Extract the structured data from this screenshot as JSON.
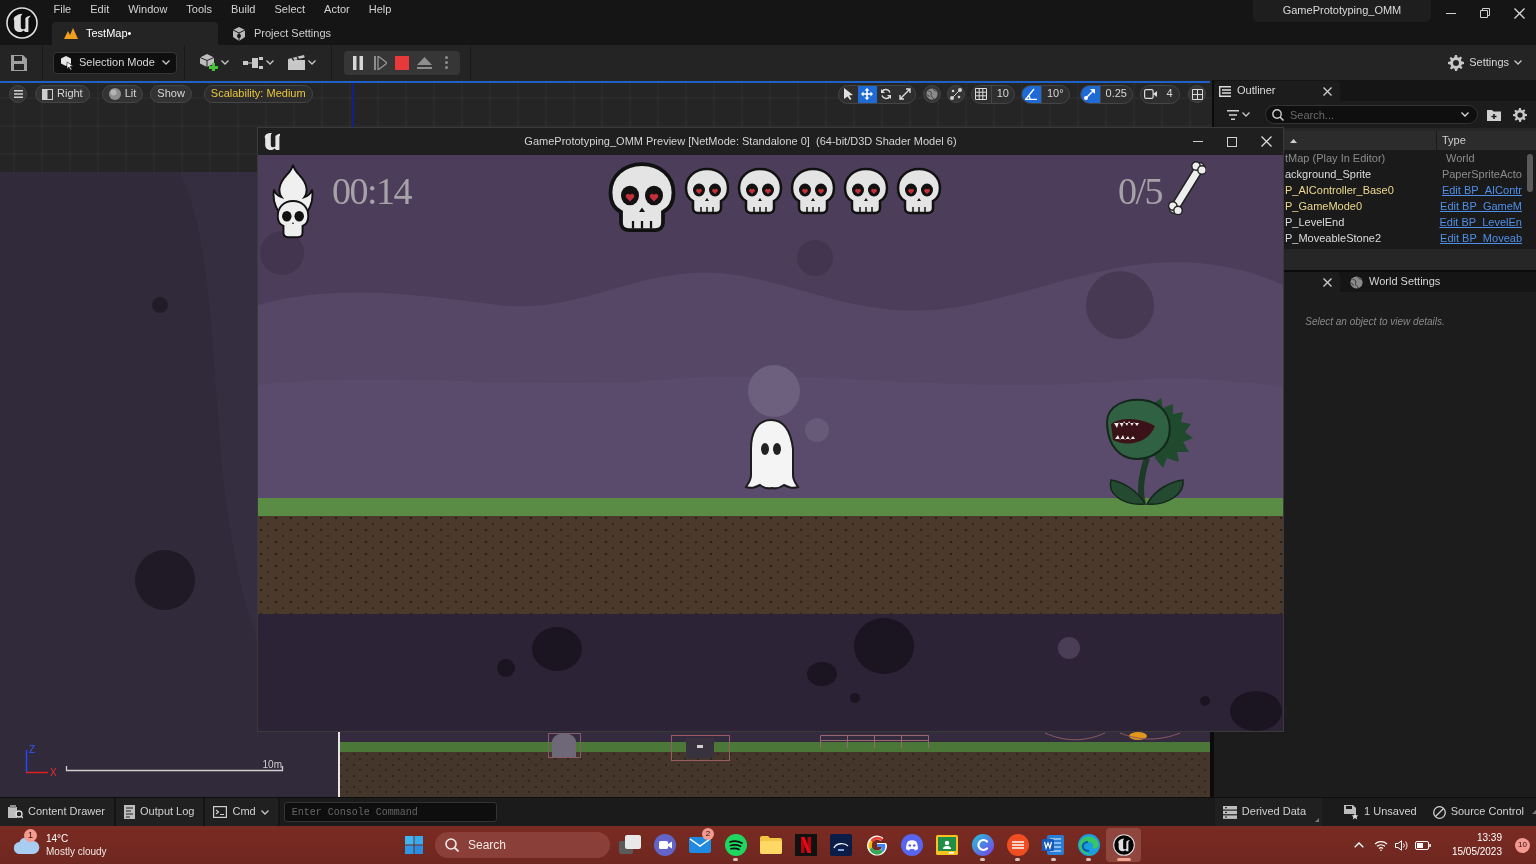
{
  "title_bar": {
    "menu": [
      "File",
      "Edit",
      "Window",
      "Tools",
      "Build",
      "Select",
      "Actor",
      "Help"
    ],
    "tabs": [
      {
        "label": "TestMap•",
        "kind": "level",
        "selected": true
      },
      {
        "label": "Project Settings",
        "kind": "settings",
        "selected": false
      }
    ],
    "project": "GamePrototyping_OMM"
  },
  "toolbar": {
    "mode": "Selection Mode",
    "settings": "Settings"
  },
  "viewport": {
    "view": "Right",
    "lighting": "Lit",
    "show": "Show",
    "scalability": "Scalability: Medium",
    "transform_tools": [
      {
        "kind": "select",
        "selected": false
      },
      {
        "kind": "move",
        "selected": true
      },
      {
        "kind": "rotate",
        "selected": false
      },
      {
        "kind": "scale",
        "selected": false
      }
    ],
    "snaps": [
      {
        "kind": "grid",
        "value": "10",
        "on": false
      },
      {
        "kind": "rotation",
        "value": "10°",
        "on": true
      },
      {
        "kind": "scale",
        "value": "0.25",
        "on": true
      }
    ],
    "camera_speed": "4",
    "axes": [
      "Z",
      "X"
    ],
    "scale_label": "10m"
  },
  "preview": {
    "title": "GamePrototyping_OMM Preview [NetMode: Standalone 0]  (64-bit/D3D Shader Model 6)",
    "timer": "00:14",
    "lives": [
      {
        "kind": "large"
      },
      {
        "kind": "small"
      },
      {
        "kind": "small"
      },
      {
        "kind": "small"
      },
      {
        "kind": "small"
      },
      {
        "kind": "small"
      }
    ],
    "bones": "0/5"
  },
  "outliner": {
    "title": "Outliner",
    "search_placeholder": "Search...",
    "type_column": "Type",
    "rows": [
      {
        "label": "tMap (Play In Editor)",
        "type": "World",
        "kind": "world",
        "link": false
      },
      {
        "label": "ackground_Sprite",
        "type": "PaperSpriteActo",
        "kind": "placed",
        "link": false
      },
      {
        "label": "P_AIController_Base0",
        "type": "Edit BP_AIContr",
        "kind": "spawned",
        "link": true
      },
      {
        "label": "P_GameMode0",
        "type": "Edit BP_GameM",
        "kind": "spawned",
        "link": true
      },
      {
        "label": "P_LevelEnd",
        "type": "Edit BP_LevelEn",
        "kind": "placed",
        "link": true
      },
      {
        "label": "P_MoveableStone2",
        "type": "Edit BP_Moveab",
        "kind": "placed",
        "link": true
      }
    ]
  },
  "details": {
    "world_settings_tab": "World Settings",
    "empty_text": "Select an object to view details."
  },
  "status_bar": {
    "left": [
      {
        "kind": "drawer",
        "label": "Content Drawer"
      },
      {
        "kind": "log",
        "label": "Output Log"
      },
      {
        "kind": "cmd",
        "label": "Cmd"
      }
    ],
    "console_placeholder": "Enter Console Command",
    "right": [
      {
        "kind": "ddc",
        "label": "Derived Data"
      },
      {
        "kind": "unsaved",
        "label": "1 Unsaved"
      },
      {
        "kind": "source",
        "label": "Source Control"
      }
    ]
  },
  "taskbar": {
    "weather": {
      "badge": "1",
      "temp": "14°C",
      "condition": "Mostly cloudy"
    },
    "search": "Search",
    "apps": [
      {
        "kind": "taskview",
        "running": false,
        "selected": false
      },
      {
        "kind": "meet",
        "running": false,
        "selected": false
      },
      {
        "kind": "mail",
        "badge": "2",
        "running": false,
        "selected": false
      },
      {
        "kind": "music",
        "running": true,
        "selected": false
      },
      {
        "kind": "files",
        "running": false,
        "selected": false
      },
      {
        "kind": "streaming",
        "running": false,
        "selected": false
      },
      {
        "kind": "movies",
        "running": false,
        "selected": false
      },
      {
        "kind": "browser",
        "running": false,
        "selected": false
      },
      {
        "kind": "chat",
        "running": false,
        "selected": false
      },
      {
        "kind": "classroom",
        "running": false,
        "selected": false
      },
      {
        "kind": "design",
        "running": true,
        "selected": false
      },
      {
        "kind": "games",
        "running": true,
        "selected": false
      },
      {
        "kind": "docs",
        "running": true,
        "selected": false
      },
      {
        "kind": "web",
        "running": true,
        "selected": false
      },
      {
        "kind": "editor",
        "running": true,
        "selected": true
      }
    ],
    "time": "13:39",
    "date": "15/05/2023",
    "notifications": "10"
  }
}
